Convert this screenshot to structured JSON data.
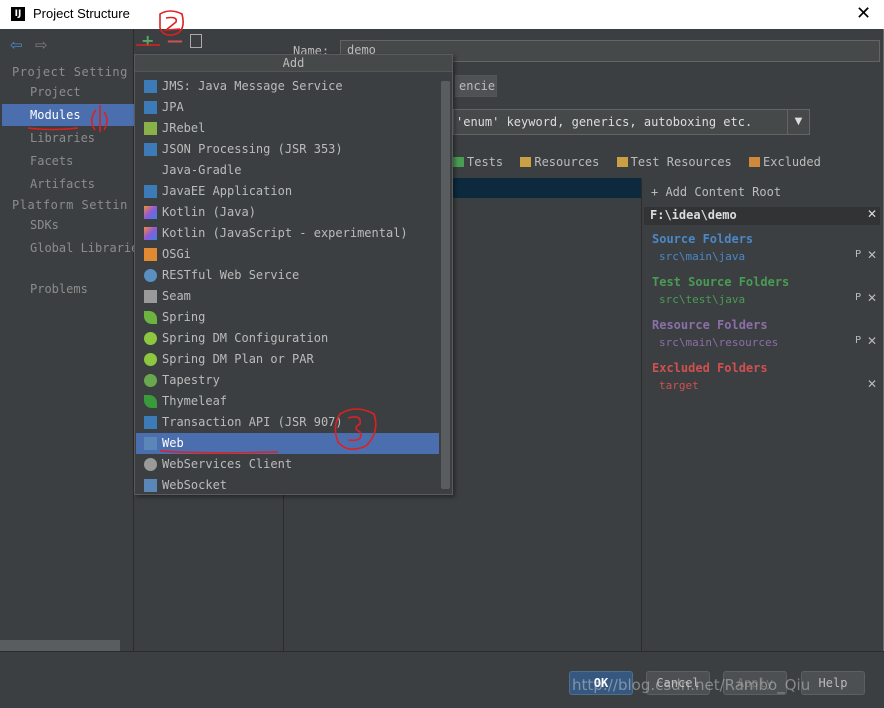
{
  "window": {
    "title": "Project Structure",
    "app_icon": "IJ"
  },
  "nav": {
    "back_glyph": "⇦",
    "forward_glyph": "⇨"
  },
  "left": {
    "project_settings": "Project Setting",
    "project_items": [
      "Project",
      "Modules",
      "Libraries",
      "Facets",
      "Artifacts"
    ],
    "platform_settings": "Platform Settin",
    "platform_items": [
      "SDKs",
      "Global Librarie"
    ],
    "problems": "Problems",
    "selected": "Modules"
  },
  "toolbar": {
    "add": "+",
    "remove": "—"
  },
  "module": {
    "name_label": "Name:",
    "name_value": "demo",
    "tab_label": "encies",
    "language_level": "'enum' keyword, generics, autoboxing etc.",
    "marks": [
      "Tests",
      "Resources",
      "Test Resources",
      "Excluded"
    ]
  },
  "roots": {
    "add_content_root": "Add Content Root",
    "root_path": "F:\\idea\\demo",
    "source_head": "Source Folders",
    "source_path": "src\\main\\java",
    "test_head": "Test Source Folders",
    "test_path": "src\\test\\java",
    "resource_head": "Resource Folders",
    "resource_path": "src\\main\\resources",
    "excluded_head": "Excluded Folders",
    "excluded_path": "target"
  },
  "popup": {
    "title": "Add",
    "items": [
      "JMS: Java Message Service",
      "JPA",
      "JRebel",
      "JSON Processing (JSR 353)",
      "Java-Gradle",
      "JavaEE Application",
      "Kotlin (Java)",
      "Kotlin (JavaScript - experimental)",
      "OSGi",
      "RESTful Web Service",
      "Seam",
      "Spring",
      "Spring DM Configuration",
      "Spring DM Plan or PAR",
      "Tapestry",
      "Thymeleaf",
      "Transaction API (JSR 907)",
      "Web",
      "WebServices Client",
      "WebSocket"
    ],
    "selected": "Web"
  },
  "buttons": {
    "ok": "OK",
    "cancel": "Cancel",
    "apply": "Apply",
    "help": "Help"
  },
  "watermark": "http://blog.csdn.net/Rambo_Qiu",
  "colors": {
    "selection": "#4b6eaf",
    "source": "#4a88c7",
    "test": "#499c54",
    "resource": "#8b6fa8",
    "excluded": "#d05050",
    "annotation": "#e02020"
  }
}
